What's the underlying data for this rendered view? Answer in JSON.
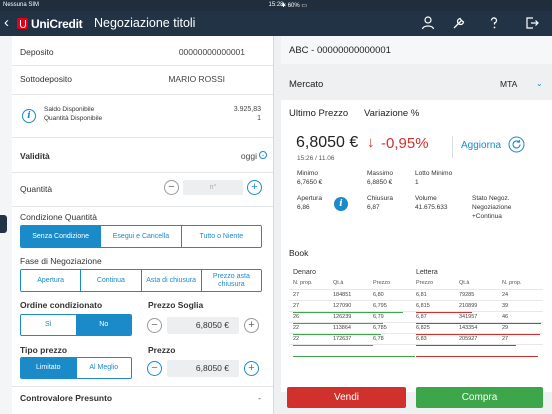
{
  "status_bar": {
    "carrier": "Nessuna SIM",
    "time": "15:28",
    "battery": "60%"
  },
  "nav": {
    "brand": "UniCredit",
    "title": "Negoziazione titoli"
  },
  "left": {
    "deposito": {
      "label": "Deposito",
      "value": "00000000000001"
    },
    "sottodeposito": {
      "label": "Sottodeposito",
      "value": "MARIO ROSSI"
    },
    "saldo": {
      "label1": "Saldo Disponibile",
      "label2": "Quantità Disponibile",
      "value1": "3.925,83",
      "value2": "1"
    },
    "validita": {
      "label": "Validità",
      "value": "oggi"
    },
    "quantita": {
      "label": "Quantità",
      "placeholder": "n°"
    },
    "condizione_quantita": {
      "label": "Condizione Quantità",
      "options": [
        "Senza Condizione",
        "Esegui e Cancella",
        "Tutto o Niente"
      ],
      "selected": 0
    },
    "fase": {
      "label": "Fase di Negoziazione",
      "options": [
        "Apertura",
        "Continua",
        "Asta di chiusura",
        "Prezzo asta chiusura"
      ]
    },
    "ordine_condizionato": {
      "label": "Ordine condizionato",
      "options": [
        "Sì",
        "No"
      ],
      "selected": 1
    },
    "prezzo_soglia": {
      "label": "Prezzo Soglia",
      "value": "6,8050 €"
    },
    "tipo_prezzo": {
      "label": "Tipo prezzo",
      "options": [
        "Limitato",
        "Al Meglio"
      ],
      "selected": 0
    },
    "prezzo": {
      "label": "Prezzo",
      "value": "6,8050 €"
    },
    "controvalore": {
      "label": "Controvalore Presunto",
      "value": "-"
    }
  },
  "right": {
    "title": "ABC - 00000000000001",
    "mercato": {
      "label": "Mercato",
      "value": "MTA"
    },
    "ultimo_prezzo_label": "Ultimo Prezzo",
    "variazione_label": "Variazione %",
    "price": "6,8050 €",
    "timestamp": "15:26 / 11.06",
    "variation": "-0,95%",
    "aggiorna": "Aggiorna",
    "stats": {
      "minimo": {
        "label": "Minimo",
        "value": "6,7650 €"
      },
      "massimo": {
        "label": "Massimo",
        "value": "6,8850 €"
      },
      "lotto": {
        "label": "Lotto Minimo",
        "value": "1"
      },
      "apertura": {
        "label": "Apertura",
        "value": "6,86"
      },
      "chiusura": {
        "label": "Chiusura",
        "value": "6,87"
      },
      "volume": {
        "label": "Volume",
        "value": "41.675.633"
      },
      "stato": {
        "label": "Stato Negoz.",
        "value1": "Negoziazione",
        "value2": "+Continua"
      }
    },
    "book": {
      "title": "Book",
      "denaro": "Denaro",
      "lettera": "Lettera",
      "headers": [
        "N. prop.",
        "Qt.à",
        "Prezzo",
        "Prezzo",
        "Qt.à",
        "N. prop."
      ],
      "rows": [
        [
          "27",
          "184851",
          "6,80",
          "6,81",
          "79285",
          "24"
        ],
        [
          "27",
          "127090",
          "6,795",
          "6,815",
          "210899",
          "39"
        ],
        [
          "26",
          "126239",
          "6,79",
          "6,87",
          "341957",
          "46"
        ],
        [
          "22",
          "113864",
          "6,785",
          "6,825",
          "143354",
          "29"
        ],
        [
          "22",
          "172637",
          "6,78",
          "6,83",
          "205927",
          "27"
        ]
      ]
    },
    "vendi": "Vendi",
    "compra": "Compra"
  }
}
